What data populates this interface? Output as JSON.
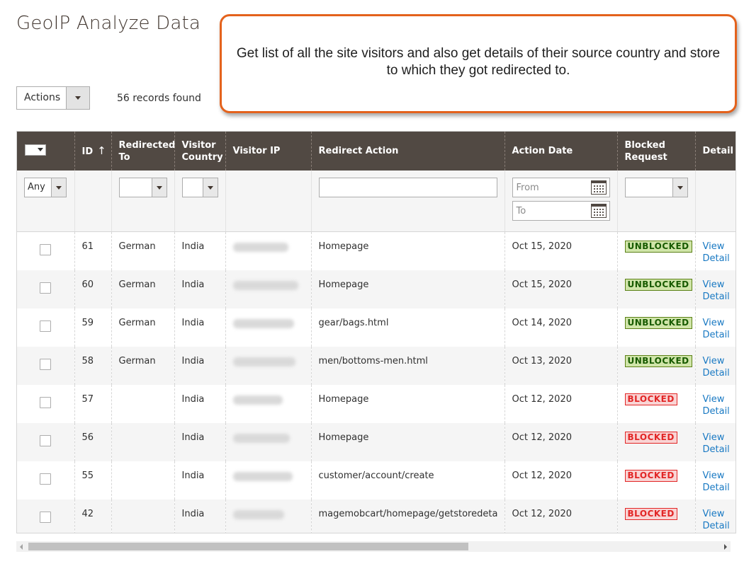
{
  "page": {
    "title": "GeoIP Analyze Data"
  },
  "callout": {
    "text": "Get list of all the site visitors and also get details of their source country and store to which they got redirected to."
  },
  "toolbar": {
    "actions_label": "Actions",
    "records_found": "56 records found"
  },
  "grid": {
    "columns": [
      {
        "key": "select",
        "label": ""
      },
      {
        "key": "id",
        "label": "ID",
        "sort": "↑"
      },
      {
        "key": "redirected_to",
        "label": "Redirected To"
      },
      {
        "key": "visitor_country",
        "label": "Visitor Country"
      },
      {
        "key": "visitor_ip",
        "label": "Visitor IP"
      },
      {
        "key": "redirect_action",
        "label": "Redirect Action"
      },
      {
        "key": "action_date",
        "label": "Action Date"
      },
      {
        "key": "blocked_request",
        "label": "Blocked Request"
      },
      {
        "key": "detail",
        "label": "Detail"
      }
    ],
    "filters": {
      "select_value": "Any",
      "date_from_placeholder": "From",
      "date_to_placeholder": "To"
    },
    "rows": [
      {
        "id": "61",
        "redirected_to": "German",
        "country": "India",
        "action": "Homepage",
        "date": "Oct 15, 2020",
        "status": "UNBLOCKED",
        "detail_view": "View",
        "detail_detail": "Detail"
      },
      {
        "id": "60",
        "redirected_to": "German",
        "country": "India",
        "action": "Homepage",
        "date": "Oct 15, 2020",
        "status": "UNBLOCKED",
        "detail_view": "View",
        "detail_detail": "Detail"
      },
      {
        "id": "59",
        "redirected_to": "German",
        "country": "India",
        "action": "gear/bags.html",
        "date": "Oct 14, 2020",
        "status": "UNBLOCKED",
        "detail_view": "View",
        "detail_detail": "Detail"
      },
      {
        "id": "58",
        "redirected_to": "German",
        "country": "India",
        "action": "men/bottoms-men.html",
        "date": "Oct 13, 2020",
        "status": "UNBLOCKED",
        "detail_view": "View",
        "detail_detail": "Detail"
      },
      {
        "id": "57",
        "redirected_to": "",
        "country": "India",
        "action": "Homepage",
        "date": "Oct 12, 2020",
        "status": "BLOCKED",
        "detail_view": "View",
        "detail_detail": "Detail"
      },
      {
        "id": "56",
        "redirected_to": "",
        "country": "India",
        "action": "Homepage",
        "date": "Oct 12, 2020",
        "status": "BLOCKED",
        "detail_view": "View",
        "detail_detail": "Detail"
      },
      {
        "id": "55",
        "redirected_to": "",
        "country": "India",
        "action": "customer/account/create",
        "date": "Oct 12, 2020",
        "status": "BLOCKED",
        "detail_view": "View",
        "detail_detail": "Detail"
      },
      {
        "id": "42",
        "redirected_to": "",
        "country": "India",
        "action": "magemobcart/homepage/getstoredeta",
        "date": "Oct 12, 2020",
        "status": "BLOCKED",
        "detail_view": "View",
        "detail_detail": "Detail"
      }
    ]
  },
  "colors": {
    "header_bg": "#514943",
    "callout_border": "#e4621c",
    "link": "#1979c3",
    "unblocked_bg": "#d0e5a9",
    "blocked_bg": "#f9d4d4"
  }
}
